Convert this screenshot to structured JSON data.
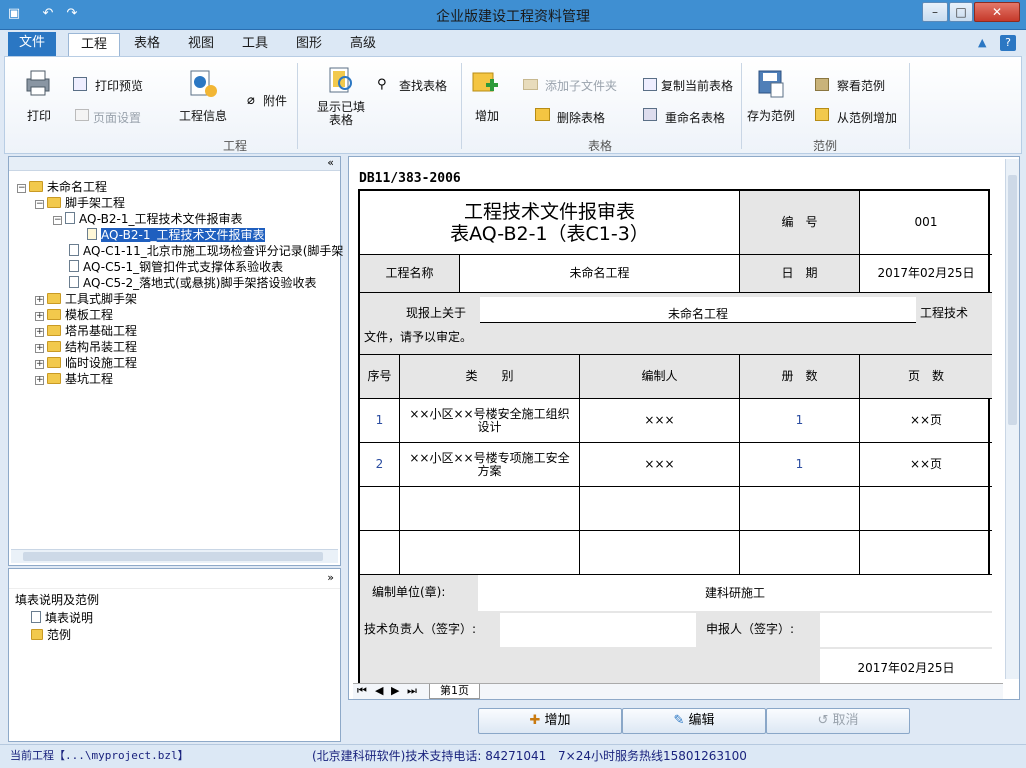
{
  "app": {
    "title": "企业版建设工程资料管理"
  },
  "menu_tabs": [
    "文件",
    "工程",
    "表格",
    "视图",
    "工具",
    "图形",
    "高级"
  ],
  "ribbon": {
    "print": "打印",
    "print_preview": "打印预览",
    "page_setup": "页面设置",
    "project_info": "工程信息",
    "attachment": "附件",
    "show_filled": "显示已填\n表格",
    "find_table": "查找表格",
    "add": "增加",
    "add_child_folder": "添加子文件夹",
    "delete_table": "删除表格",
    "copy_current_table": "复制当前表格",
    "rename_table": "重命名表格",
    "save_as_example": "存为范例",
    "view_example": "察看范例",
    "add_from_example": "从范例增加",
    "group_project": "工程",
    "group_table": "表格",
    "group_example": "范例"
  },
  "tree": {
    "root": "未命名工程",
    "n1": "脚手架工程",
    "n2": "AQ-B2-1_工程技术文件报审表",
    "n3": "AQ-B2-1_工程技术文件报审表",
    "n4": "AQ-C1-11_北京市施工现场检查评分记录(脚手架",
    "n5": "AQ-C5-1_钢管扣件式支撑体系验收表",
    "n6": "AQ-C5-2_落地式(或悬挑)脚手架搭设验收表",
    "n7": "工具式脚手架",
    "n8": "模板工程",
    "n9": "塔吊基础工程",
    "n10": "结构吊装工程",
    "n11": "临时设施工程",
    "n12": "基坑工程"
  },
  "help_pane": {
    "title": "填表说明及范例",
    "item1": "填表说明",
    "item2": "范例"
  },
  "form": {
    "doc_code": "DB11/383-2006",
    "title1": "工程技术文件报审表",
    "title2": "表AQ-B2-1（表C1-3）",
    "label_no": "编　号",
    "value_no": "001",
    "label_project": "工程名称",
    "value_project": "未命名工程",
    "label_date": "日　期",
    "value_date": "2017年02月25日",
    "report_prefix": "现报上关于",
    "report_project": "未命名工程",
    "report_suffix": "工程技术",
    "report_line2": "文件，请予以审定。",
    "col_no": "序号",
    "col_type": "类　　别",
    "col_author": "编制人",
    "col_vol": "册　数",
    "col_pages": "页　数",
    "rows": [
      {
        "no": "1",
        "type": "××小区××号楼安全施工组织设计",
        "author": "×××",
        "vol": "1",
        "pages": "××页"
      },
      {
        "no": "2",
        "type": "××小区××号楼专项施工安全方案",
        "author": "×××",
        "vol": "1",
        "pages": "××页"
      }
    ],
    "label_unit": "编制单位(章):",
    "value_unit": "建科研施工",
    "label_tech_lead": "技术负责人（签字）:",
    "label_applicant": "申报人（签字）:",
    "sign_date": "2017年02月25日"
  },
  "sheet_tab": "第1页",
  "buttons": {
    "add": "增加",
    "edit": "编辑",
    "cancel": "取消"
  },
  "status": {
    "current_project": "当前工程【...\\myproject.bzl】",
    "support": "(北京建科研软件)技术支持电话: 84271041",
    "hotline": "7×24小时服务热线15801263100"
  },
  "colors": {
    "title_bar": "#3f8fd2",
    "file_tab": "#2b77c3",
    "selection": "#1f5fbf"
  }
}
